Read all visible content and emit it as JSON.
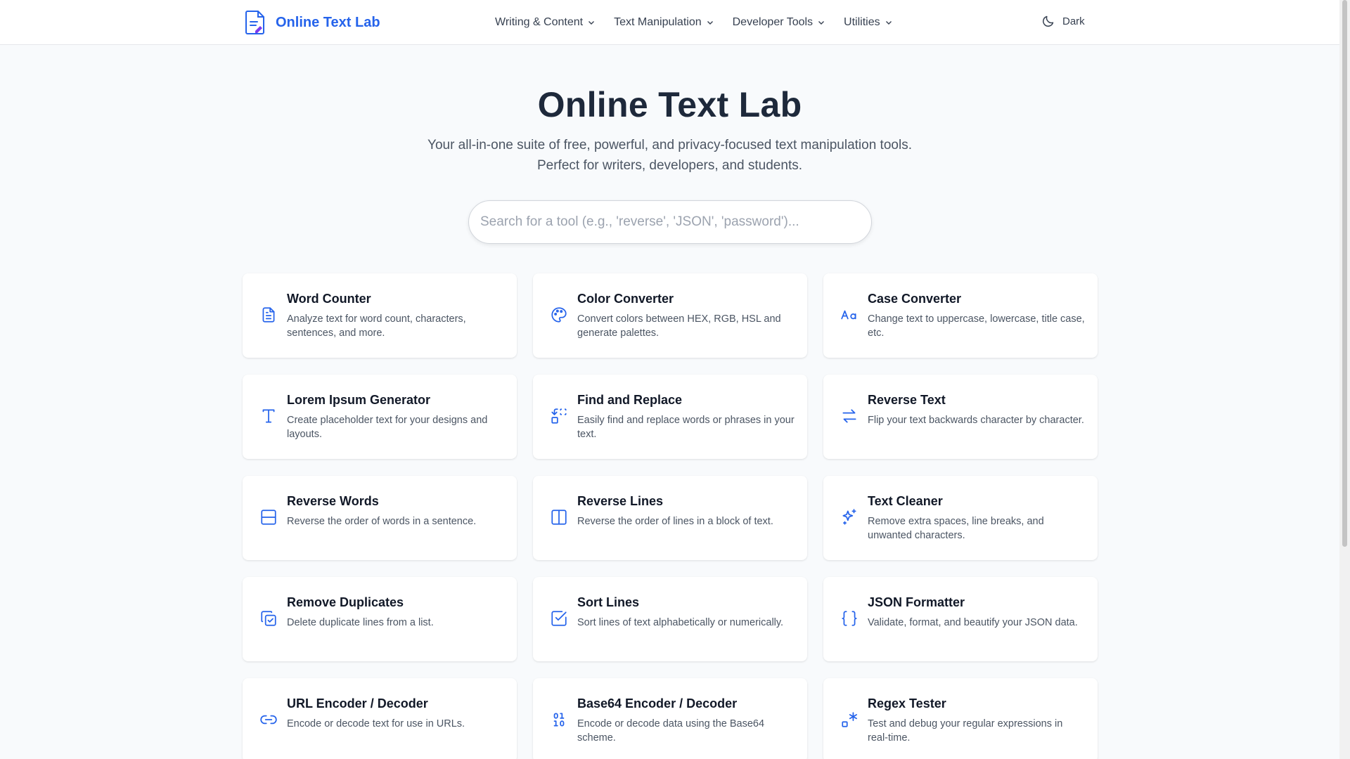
{
  "header": {
    "logo_text": "Online Text Lab",
    "logo_icon": "document-icon",
    "nav": [
      {
        "label": "Writing & Content"
      },
      {
        "label": "Text Manipulation"
      },
      {
        "label": "Developer Tools"
      },
      {
        "label": "Utilities"
      }
    ],
    "theme_toggle_label": "Dark"
  },
  "hero": {
    "title": "Online Text Lab",
    "subtitle_line1": "Your all-in-one suite of free, powerful, and privacy-focused text manipulation tools.",
    "subtitle_line2": "Perfect for writers, developers, and students.",
    "search_placeholder": "Search for a tool (e.g., 'reverse', 'JSON', 'password')..."
  },
  "colors": {
    "accent": "#2563eb",
    "title": "#1e293b",
    "background": "#f8fafc"
  },
  "tools": [
    {
      "title": "Word Counter",
      "desc": "Analyze text for word count, characters, sentences, and more.",
      "icon": "document-icon"
    },
    {
      "title": "Color Converter",
      "desc": "Convert colors between HEX, RGB, HSL and generate palettes.",
      "icon": "palette-icon"
    },
    {
      "title": "Case Converter",
      "desc": "Change text to uppercase, lowercase, title case, etc.",
      "icon": "case-icon"
    },
    {
      "title": "Lorem Ipsum Generator",
      "desc": "Create placeholder text for your designs and layouts.",
      "icon": "text-icon"
    },
    {
      "title": "Find and Replace",
      "desc": "Easily find and replace words or phrases in your text.",
      "icon": "replace-icon"
    },
    {
      "title": "Reverse Text",
      "desc": "Flip your text backwards character by character.",
      "icon": "swap-arrows-icon"
    },
    {
      "title": "Reverse Words",
      "desc": "Reverse the order of words in a sentence.",
      "icon": "rows-icon"
    },
    {
      "title": "Reverse Lines",
      "desc": "Reverse the order of lines in a block of text.",
      "icon": "columns-icon"
    },
    {
      "title": "Text Cleaner",
      "desc": "Remove extra spaces, line breaks, and unwanted characters.",
      "icon": "sparkles-icon"
    },
    {
      "title": "Remove Duplicates",
      "desc": "Delete duplicate lines from a list.",
      "icon": "copy-check-icon"
    },
    {
      "title": "Sort Lines",
      "desc": "Sort lines of text alphabetically or numerically.",
      "icon": "square-check-icon"
    },
    {
      "title": "JSON Formatter",
      "desc": "Validate, format, and beautify your JSON data.",
      "icon": "braces-icon"
    },
    {
      "title": "URL Encoder / Decoder",
      "desc": "Encode or decode text for use in URLs.",
      "icon": "link-icon"
    },
    {
      "title": "Base64 Encoder / Decoder",
      "desc": "Encode or decode data using the Base64 scheme.",
      "icon": "binary-icon"
    },
    {
      "title": "Regex Tester",
      "desc": "Test and debug your regular expressions in real-time.",
      "icon": "regex-icon"
    }
  ]
}
